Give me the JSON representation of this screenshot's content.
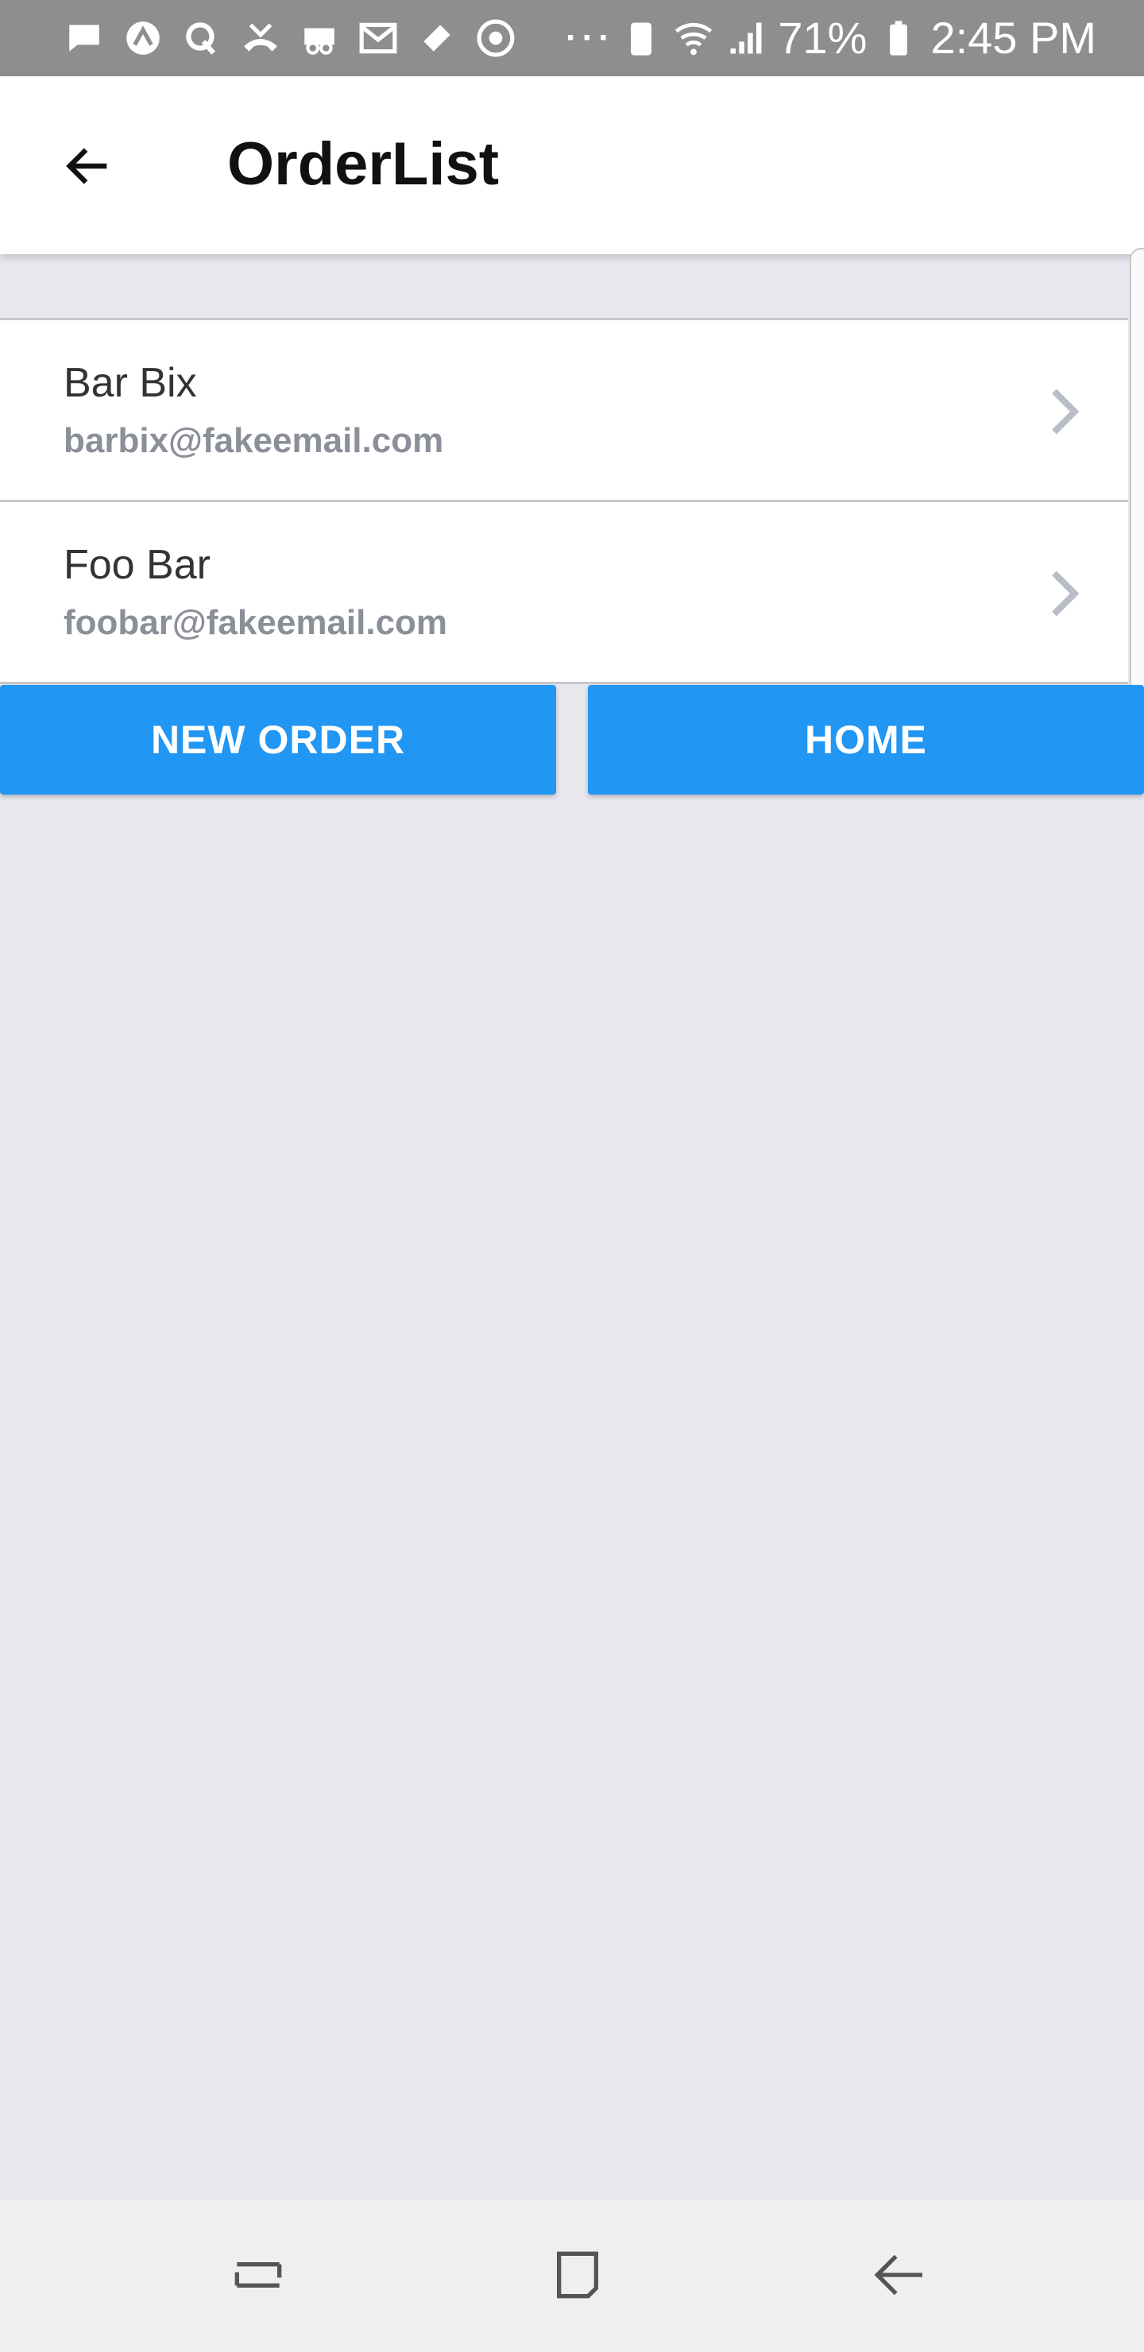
{
  "status_bar": {
    "battery_percent": "71%",
    "time": "2:45 PM",
    "notification_icons": [
      "message-icon",
      "app-icon",
      "quora-icon",
      "missed-call-icon",
      "voicemail-icon",
      "gmail-icon",
      "ticket-icon",
      "chrome-icon"
    ],
    "overflow": "···"
  },
  "header": {
    "title": "OrderList"
  },
  "orders": [
    {
      "name": "Bar Bix",
      "email": "barbix@fakeemail.com"
    },
    {
      "name": "Foo Bar",
      "email": "foobar@fakeemail.com"
    }
  ],
  "actions": {
    "new_order_label": "NEW ORDER",
    "home_label": "HOME"
  },
  "colors": {
    "accent": "#2196f3",
    "background": "#e8e7ee",
    "status_bar": "#8e8e8e"
  }
}
